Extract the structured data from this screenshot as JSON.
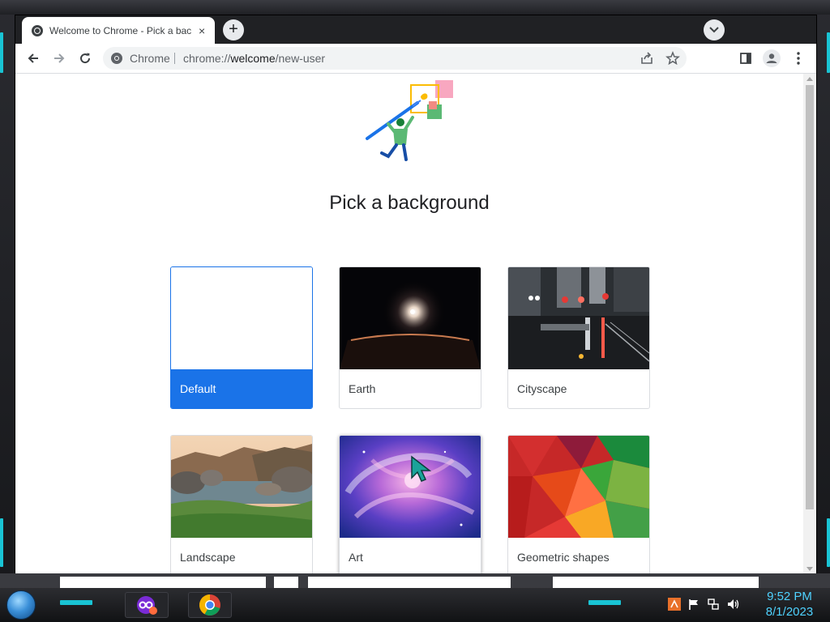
{
  "browser": {
    "tab": {
      "title": "Welcome to Chrome - Pick a bac",
      "close": "×"
    },
    "new_tab_label": "+",
    "omnibox": {
      "chip": "Chrome",
      "url_scheme": "chrome://",
      "url_host": "welcome",
      "url_path": "/new-user"
    }
  },
  "page": {
    "heading": "Pick a background",
    "backgrounds": [
      {
        "label": "Default",
        "selected": true
      },
      {
        "label": "Earth"
      },
      {
        "label": "Cityscape"
      },
      {
        "label": "Landscape"
      },
      {
        "label": "Art",
        "hover": true
      },
      {
        "label": "Geometric shapes"
      }
    ]
  },
  "colors": {
    "accent": "#1a73e8",
    "clock": "#4fd2ff",
    "skin_cyan": "#19c4d4"
  },
  "taskbar": {
    "clock_time": "9:52 PM",
    "clock_date": "8/1/2023",
    "icons": [
      "start-orb",
      "app-icon",
      "chrome-icon"
    ],
    "tray_icons": [
      "app-tray-icon",
      "flag-icon",
      "network-icon",
      "volume-icon"
    ]
  }
}
